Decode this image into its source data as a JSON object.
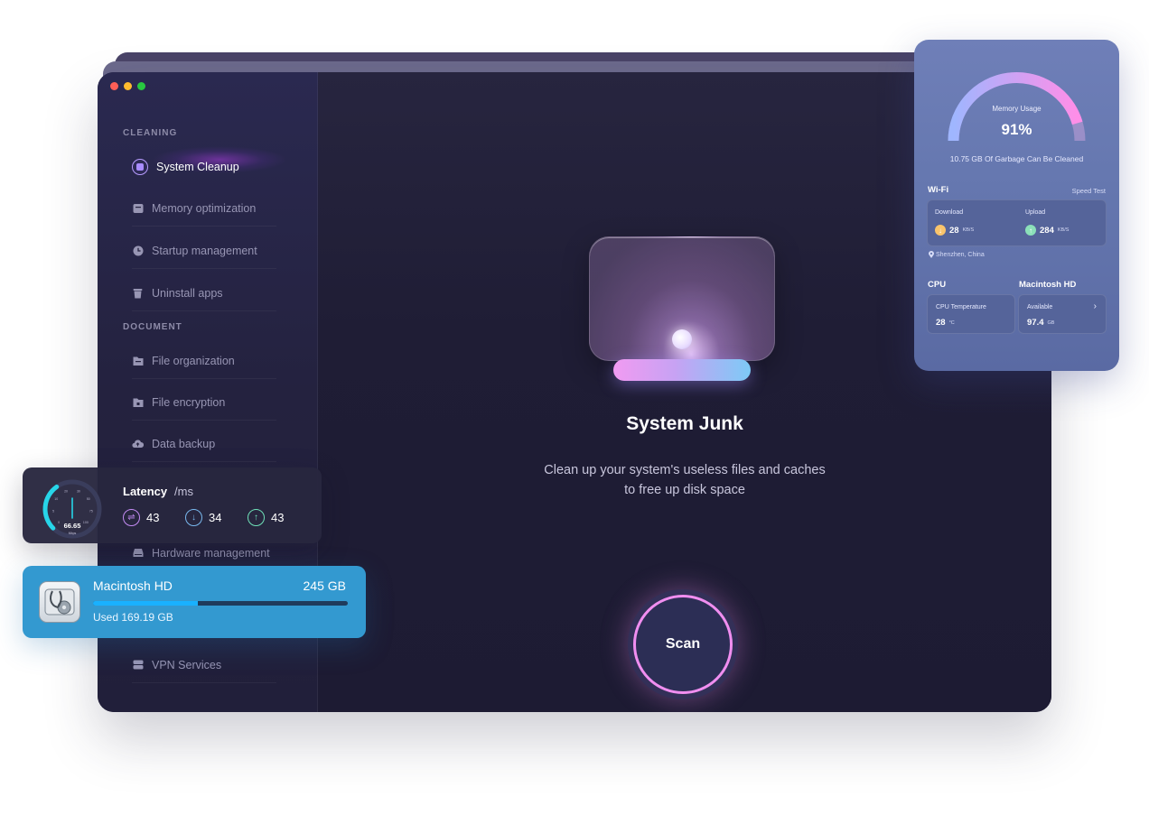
{
  "sidebar": {
    "sections": [
      {
        "label": "CLEANING",
        "items": [
          "System Cleanup",
          "Memory optimization",
          "Startup management",
          "Uninstall apps"
        ]
      },
      {
        "label": "DOCUMENT",
        "items": [
          "File organization",
          "File encryption",
          "Data backup"
        ]
      }
    ],
    "more_items": [
      "Hardware management",
      "VPN Services"
    ],
    "active_item": "System Cleanup"
  },
  "main": {
    "title": "System Junk",
    "description_line1": "Clean up your system's useless files and caches",
    "description_line2": "to free up disk space",
    "scan_label": "Scan"
  },
  "memory_card": {
    "gauge_label": "Memory Usage",
    "usage": "91%",
    "usage_fraction": 0.91,
    "garbage_amount": "10.75",
    "garbage_text": "GB Of Garbage Can Be Cleaned",
    "wifi_title": "Wi-Fi",
    "speed_test_label": "Speed Test",
    "download_label": "Download",
    "download_value": "28",
    "download_unit": "KB/S",
    "upload_label": "Upload",
    "upload_value": "284",
    "upload_unit": "KB/S",
    "location": "Shenzhen, China",
    "cpu_title": "CPU",
    "cpu_temp_label": "CPU Temperature",
    "cpu_temp_value": "28",
    "cpu_temp_unit": "°C",
    "disk_title": "Macintosh HD",
    "available_label": "Available",
    "available_value": "97.4",
    "available_unit": "GB",
    "colors": {
      "gauge_start": "#9fb6ff",
      "gauge_end": "#ff8ee8",
      "gauge_track": "#9a8fc8"
    }
  },
  "latency_card": {
    "title": "Latency",
    "unit": "/ms",
    "speed": "66.65",
    "speed_unit": "Mbps",
    "gauge_ticks": [
      "0",
      "5",
      "10",
      "20",
      "30",
      "50",
      "75",
      "100"
    ],
    "stats": [
      {
        "icon": "swap-icon",
        "value": "43",
        "color": "#c38bf3"
      },
      {
        "icon": "arrow-down-icon",
        "value": "34",
        "color": "#79b8ee"
      },
      {
        "icon": "arrow-up-icon",
        "value": "43",
        "color": "#6fe0b8"
      }
    ],
    "gauge_color": "#27d5e8"
  },
  "disk_card": {
    "name": "Macintosh HD",
    "size": "245 GB",
    "used_text": "Used 169.19 GB",
    "used_fraction": 0.41,
    "colors": {
      "background": "#3399d0",
      "fill": "#19b1ff"
    }
  }
}
